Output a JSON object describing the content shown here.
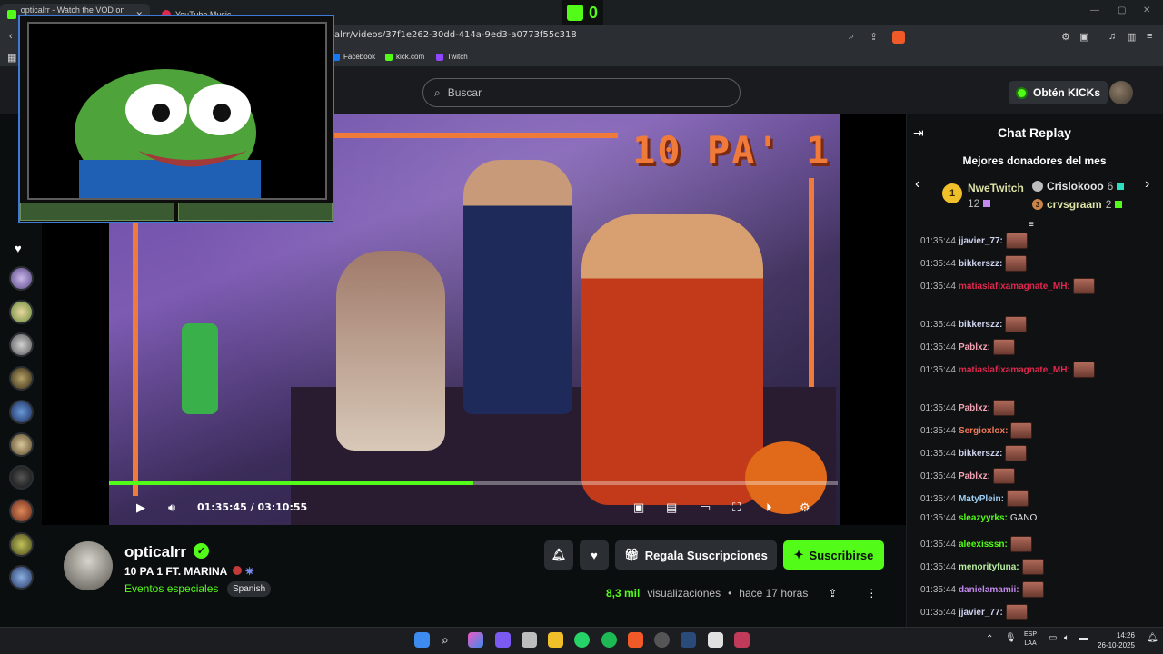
{
  "browser": {
    "tabs": [
      {
        "label": "opticalrr - Watch the VOD on Ki",
        "active": true
      },
      {
        "label": "YouTube Music",
        "active": false
      }
    ],
    "url": "alrr/videos/37f1e262-30dd-414a-9ed3-a0773f55c318",
    "bookmarks": [
      "Facebook",
      "kick.com",
      "Twitch"
    ]
  },
  "overlay_counter": "0",
  "header": {
    "search_placeholder": "Buscar",
    "kicks_button": "Obtén KICKs"
  },
  "player": {
    "overlay_text": "10 PA' 1",
    "time_current": "01:35:45",
    "time_total": "03:10:55",
    "progress": 0.5
  },
  "channel": {
    "name": "opticalrr",
    "title": "10 PA 1 FT. MARINA",
    "category": "Eventos especiales",
    "language": "Spanish",
    "gift_button": "Regala Suscripciones",
    "subscribe_button": "Suscribirse",
    "views": "8,3 mil",
    "views_label": "visualizaciones",
    "time_ago": "hace 17 horas"
  },
  "chat": {
    "title": "Chat Replay",
    "donors_title": "Mejores donadores del mes",
    "donors": [
      {
        "rank": "1",
        "name": "NweTwitch",
        "count": "12"
      },
      {
        "rank": "",
        "name": "Crislokooo",
        "count": "6"
      },
      {
        "rank": "3",
        "name": "crvsgraam",
        "count": "2"
      }
    ],
    "messages": [
      {
        "time": "01:35:44",
        "user": "jjavier_77:",
        "color": "#cfd3f0",
        "text": ""
      },
      {
        "time": "01:35:44",
        "user": "bikkerszz:",
        "color": "#cfd3f0",
        "text": ""
      },
      {
        "time": "01:35:44",
        "user": "matiaslafixamagnate_MH:",
        "color": "#e0284f",
        "text": ""
      },
      {
        "time": "01:35:44",
        "user": "bikkerszz:",
        "color": "#cfd3f0",
        "text": ""
      },
      {
        "time": "01:35:44",
        "user": "Pablxz:",
        "color": "#f5a3b5",
        "text": ""
      },
      {
        "time": "01:35:44",
        "user": "matiaslafixamagnate_MH:",
        "color": "#e0284f",
        "text": ""
      },
      {
        "time": "01:35:44",
        "user": "Pablxz:",
        "color": "#f5a3b5",
        "text": ""
      },
      {
        "time": "01:35:44",
        "user": "Sergioxlox:",
        "color": "#f07a5a",
        "text": ""
      },
      {
        "time": "01:35:44",
        "user": "bikkerszz:",
        "color": "#cfd3f0",
        "text": ""
      },
      {
        "time": "01:35:44",
        "user": "Pablxz:",
        "color": "#f5a3b5",
        "text": ""
      },
      {
        "time": "01:35:44",
        "user": "MatyPlein:",
        "color": "#9fd0f5",
        "text": ""
      },
      {
        "time": "01:35:44",
        "user": "sleazyyrks:",
        "color": "#53fc18",
        "text": "GANO"
      },
      {
        "time": "01:35:44",
        "user": "aleexisssn:",
        "color": "#53fc18",
        "text": ""
      },
      {
        "time": "01:35:44",
        "user": "menorityfuna:",
        "color": "#b9f0a0",
        "text": ""
      },
      {
        "time": "01:35:44",
        "user": "danielamamii:",
        "color": "#c58af0",
        "text": ""
      },
      {
        "time": "01:35:44",
        "user": "jjavier_77:",
        "color": "#cfd3f0",
        "text": ""
      }
    ]
  },
  "taskbar": {
    "lang_top": "ESP",
    "lang_bottom": "LAA",
    "time": "14:26",
    "date": "26-10-2025"
  },
  "colors": {
    "accent": "#53fc18",
    "background": "#0b0e0f",
    "panel": "#2b2f33"
  }
}
